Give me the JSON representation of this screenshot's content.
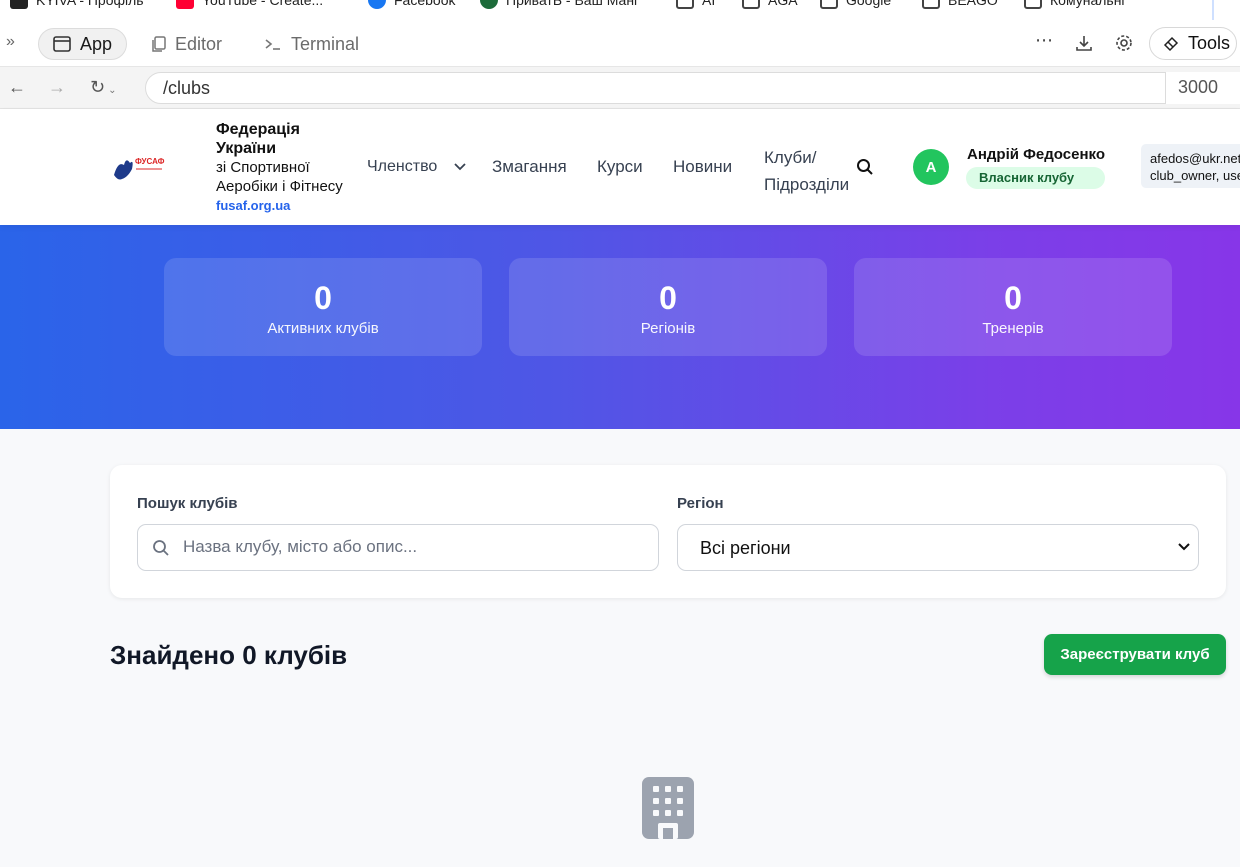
{
  "bookmarks": [
    "KYIVA - Профіль",
    "YouTube - Create...",
    "Facebook",
    "ПриватБ - Ваш Мані",
    "AI",
    "AGA",
    "Google",
    "BEAGO",
    "Комунальні"
  ],
  "toolbar": {
    "tabs": [
      {
        "label": "App",
        "icon": "app-window-icon",
        "active": true
      },
      {
        "label": "Editor",
        "icon": "file-icon",
        "active": false
      },
      {
        "label": "Terminal",
        "icon": "terminal-icon",
        "active": false
      }
    ],
    "tools_label": "Tools"
  },
  "address": {
    "url": "/clubs",
    "port": "3000"
  },
  "site": {
    "brand_line1": "Федерація",
    "brand_line2": "України",
    "brand_line3": "зі Спортивної",
    "brand_line4": "Аеробіки і Фітнесу",
    "brand_link": "fusaf.org.ua",
    "nav": [
      "Членство",
      "Змагання",
      "Курси",
      "Новини",
      "Клуби/",
      "Підрозділи"
    ],
    "user": {
      "initial": "А",
      "name": "Андрій Федосенко",
      "role": "Власник клубу",
      "debug_line1": "afedos@ukr.net",
      "debug_line2": "club_owner, user"
    }
  },
  "hero": {
    "stats": [
      {
        "value": "0",
        "label": "Активних клубів"
      },
      {
        "value": "0",
        "label": "Регіонів"
      },
      {
        "value": "0",
        "label": "Тренерів"
      }
    ]
  },
  "filters": {
    "search_label": "Пошук клубів",
    "search_placeholder": "Назва клубу, місто або опис...",
    "region_label": "Регіон",
    "region_selected": "Всі регіони"
  },
  "results": {
    "title": "Знайдено 0 клубів",
    "register_label": "Зареєструвати клуб"
  },
  "colors": {
    "accent_green": "#16a34a",
    "brand_blue": "#2563eb",
    "hero_start": "#2a64e9",
    "hero_end": "#8736e8"
  }
}
